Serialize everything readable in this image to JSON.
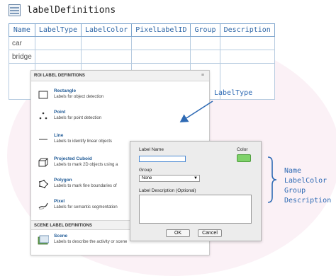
{
  "header": {
    "title": "labelDefinitions"
  },
  "table": {
    "columns": [
      "Name",
      "LabelType",
      "LabelColor",
      "PixelLabelID",
      "Group",
      "Description"
    ],
    "rows": [
      [
        "car",
        "",
        "",
        "",
        "",
        ""
      ],
      [
        "bridge",
        "",
        "",
        "",
        "",
        ""
      ]
    ]
  },
  "roi_panel": {
    "header": "ROI LABEL DEFINITIONS",
    "items": [
      {
        "title": "Rectangle",
        "desc": "Labels for object detection",
        "icon": "rectangle-icon"
      },
      {
        "title": "Point",
        "desc": "Labels for point detection",
        "icon": "point-icon"
      },
      {
        "title": "Line",
        "desc": "Labels to identify linear objects",
        "icon": "line-icon"
      },
      {
        "title": "Projected Cuboid",
        "desc": "Labels to mark 2D objects using a",
        "icon": "cuboid-icon"
      },
      {
        "title": "Polygon",
        "desc": "Labels to mark fine boundaries of",
        "icon": "polygon-icon"
      },
      {
        "title": "Pixel",
        "desc": "Labels for semantic segmentation",
        "icon": "pixel-brush-icon"
      }
    ],
    "scene_header": "SCENE LABEL DEFINITIONS",
    "scene_item": {
      "title": "Scene",
      "desc": "Labels to describe the activity or scene",
      "icon": "scene-icon"
    }
  },
  "dialog": {
    "label_name_label": "Label Name",
    "color_label": "Color",
    "group_label": "Group",
    "group_value": "None",
    "description_label": "Label Description (Optional)",
    "ok_label": "OK",
    "cancel_label": "Cancel",
    "color": "#7fd26a"
  },
  "callouts": {
    "labeltype": "LabelType",
    "fields": [
      "Name",
      "LabelColor",
      "Group",
      "Description"
    ]
  },
  "colors": {
    "accent": "#2e6ab4",
    "table_header_text": "#2f67a7"
  }
}
